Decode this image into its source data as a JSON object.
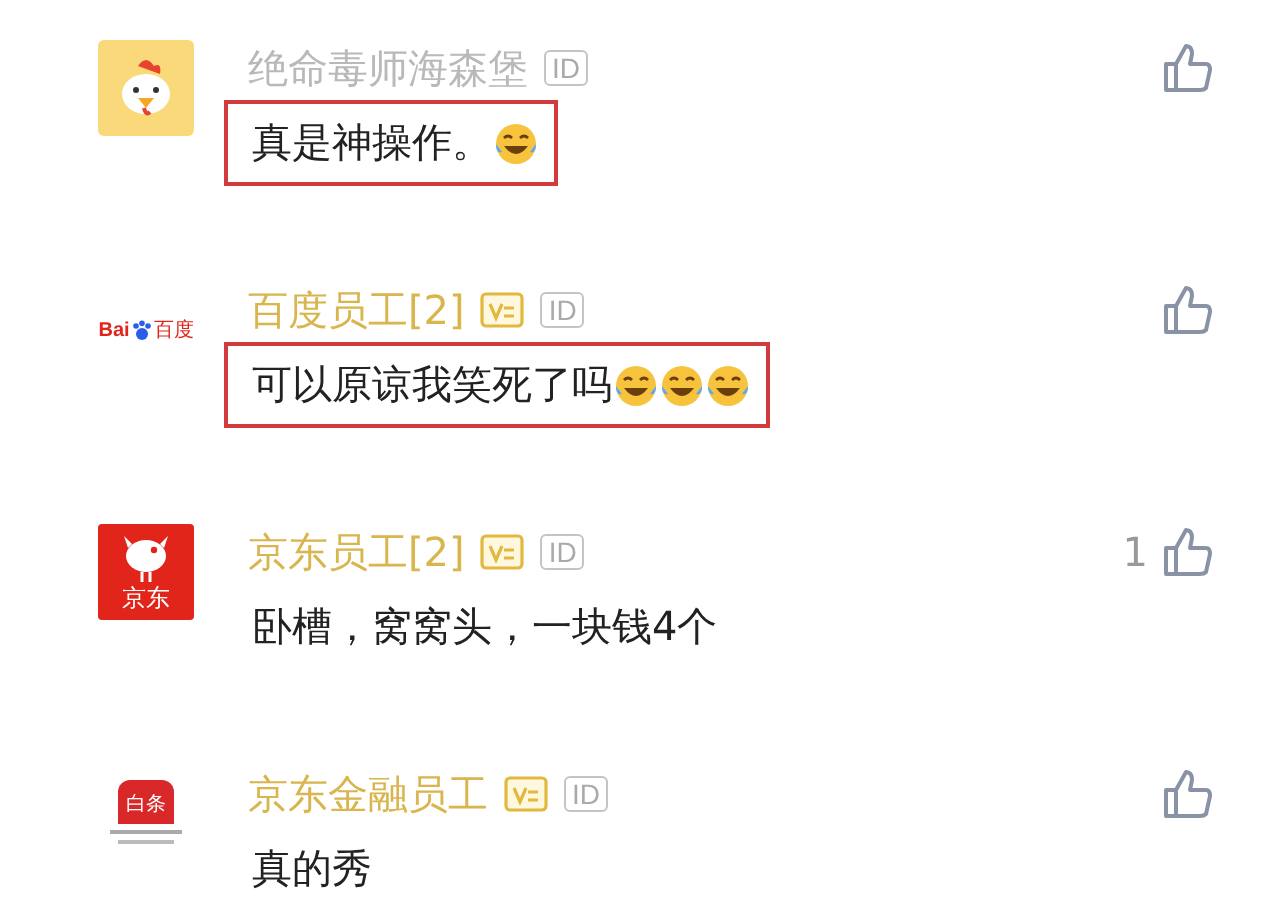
{
  "comments": [
    {
      "avatar": {
        "kind": "chicken"
      },
      "name": "绝命毒师海森堡",
      "official": false,
      "id_badge": "ID",
      "text": "真是神操作。",
      "emojis": [
        {
          "kind": "laugh-cry"
        }
      ],
      "highlighted": true
    },
    {
      "avatar": {
        "kind": "baidu",
        "labels": [
          "Bai",
          "百度"
        ]
      },
      "name": "百度员工[2]",
      "official": true,
      "id_badge": "ID",
      "text": "可以原谅我笑死了吗",
      "emojis": [
        {
          "kind": "laugh-cry"
        },
        {
          "kind": "laugh-cry"
        },
        {
          "kind": "laugh-cry"
        }
      ],
      "highlighted": true
    },
    {
      "avatar": {
        "kind": "jd",
        "labels": [
          "京东"
        ]
      },
      "name": "京东员工[2]",
      "official": true,
      "id_badge": "ID",
      "text": "卧槽，窝窝头，一块钱4个",
      "highlighted": false,
      "likes": "1"
    },
    {
      "avatar": {
        "kind": "baitiao",
        "labels": [
          "白条"
        ]
      },
      "name": "京东金融员工",
      "official": true,
      "id_badge": "ID",
      "text": "真的秀",
      "highlighted": false
    }
  ]
}
